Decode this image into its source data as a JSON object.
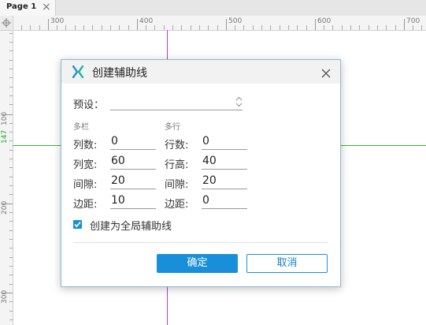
{
  "tab": {
    "label": "Page 1",
    "close": "×"
  },
  "ruler": {
    "top_labels": [
      "300",
      "400",
      "500",
      "600",
      "700"
    ],
    "left_labels": [
      "100",
      "147",
      "200",
      "300"
    ]
  },
  "dialog": {
    "title": "创建辅助线",
    "preset_label": "预设：",
    "preset_value": "",
    "columns_section": "多栏",
    "rows_section": "多行",
    "columns": {
      "count_label": "列数:",
      "count": "0",
      "width_label": "列宽:",
      "width": "60",
      "gap_label": "间隙:",
      "gap": "20",
      "margin_label": "边距:",
      "margin": "10"
    },
    "rows": {
      "count_label": "行数:",
      "count": "0",
      "height_label": "行高:",
      "height": "40",
      "gap_label": "间隙:",
      "gap": "20",
      "margin_label": "边距:",
      "margin": "0"
    },
    "global_checkbox_label": "创建为全局辅助线",
    "global_checked": true,
    "ok_label": "确定",
    "cancel_label": "取消"
  },
  "colors": {
    "accent": "#1a8fd9",
    "vertical_guide": "#cc33cc",
    "horizontal_guide": "#33bb33"
  }
}
